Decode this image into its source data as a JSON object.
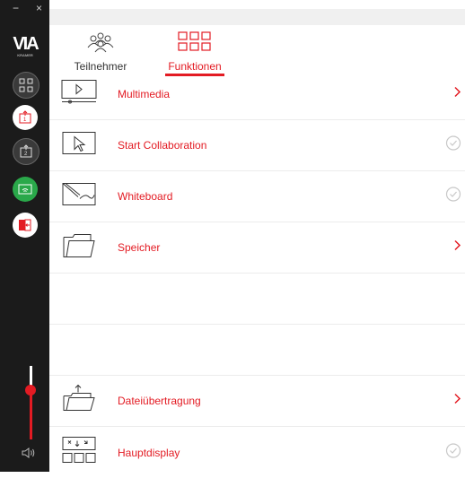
{
  "window": {
    "minimize_glyph": "−",
    "close_glyph": "×"
  },
  "logo": {
    "text": "VIA",
    "subtext": "KRAMER"
  },
  "sidebar": {
    "items": [
      {
        "icon": "share-screen-icon"
      },
      {
        "icon": "present-1-icon"
      },
      {
        "icon": "present-2-icon"
      },
      {
        "icon": "wireless-display-icon"
      },
      {
        "icon": "exit-icon"
      }
    ],
    "volume_level": 0.67,
    "speaker_icon": "speaker-icon"
  },
  "tabs": [
    {
      "label": "Teilnehmer",
      "icon": "participants-icon",
      "active": false
    },
    {
      "label": "Funktionen",
      "icon": "functions-grid-icon",
      "active": true
    }
  ],
  "functions": [
    {
      "label": "Multimedia",
      "icon": "multimedia-icon",
      "action": "chevron"
    },
    {
      "label": "Start Collaboration",
      "icon": "collaboration-icon",
      "action": "check"
    },
    {
      "label": "Whiteboard",
      "icon": "whiteboard-icon",
      "action": "check"
    },
    {
      "label": "Speicher",
      "icon": "folder-icon",
      "action": "chevron"
    },
    {
      "label": "",
      "icon": "",
      "action": ""
    },
    {
      "label": "",
      "icon": "",
      "action": ""
    },
    {
      "label": "Dateiübertragung",
      "icon": "file-transfer-icon",
      "action": "chevron"
    },
    {
      "label": "Hauptdisplay",
      "icon": "main-display-icon",
      "action": "check"
    }
  ],
  "colors": {
    "accent": "#e31b23",
    "sidebar": "#1b1b1b",
    "check": "#c8c8c8"
  }
}
